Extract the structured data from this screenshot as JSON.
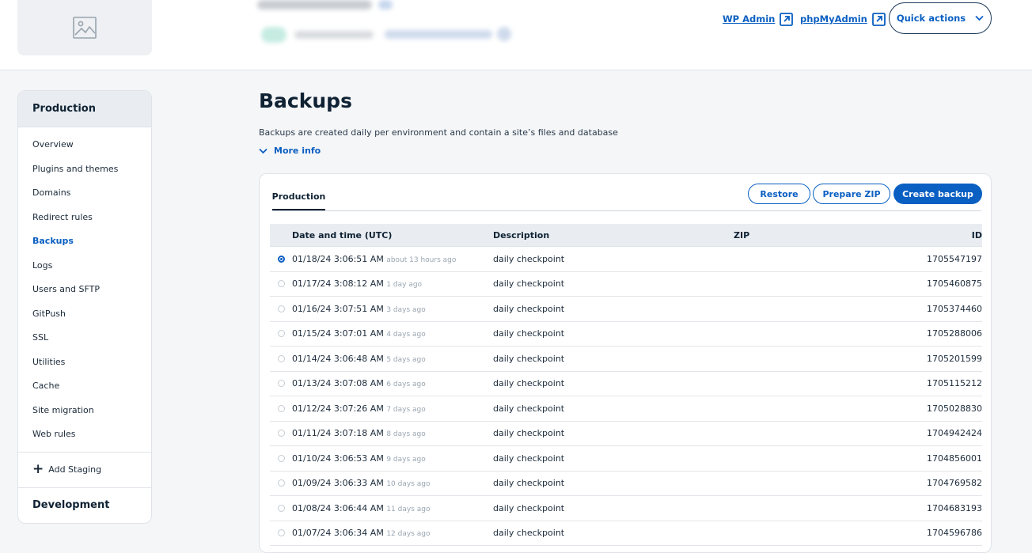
{
  "header": {
    "links": [
      {
        "label": "WP Admin",
        "icon": "external-link-icon"
      },
      {
        "label": "phpMyAdmin",
        "icon": "external-link-icon"
      }
    ],
    "quick_actions_label": "Quick actions",
    "site_thumbnail_icon": "image-placeholder-icon"
  },
  "sidebar": {
    "section_title": "Production",
    "items": [
      {
        "label": "Overview",
        "active": false
      },
      {
        "label": "Plugins and themes",
        "active": false
      },
      {
        "label": "Domains",
        "active": false
      },
      {
        "label": "Redirect rules",
        "active": false
      },
      {
        "label": "Backups",
        "active": true
      },
      {
        "label": "Logs",
        "active": false
      },
      {
        "label": "Users and SFTP",
        "active": false
      },
      {
        "label": "GitPush",
        "active": false
      },
      {
        "label": "SSL",
        "active": false
      },
      {
        "label": "Utilities",
        "active": false
      },
      {
        "label": "Cache",
        "active": false
      },
      {
        "label": "Site migration",
        "active": false
      },
      {
        "label": "Web rules",
        "active": false
      }
    ],
    "add_staging_label": "Add Staging",
    "development_title": "Development"
  },
  "main": {
    "title": "Backups",
    "description": "Backups are created daily per environment and contain a site’s files and database",
    "more_info_label": "More info",
    "tab_label": "Production",
    "buttons": {
      "restore": "Restore",
      "prepare_zip": "Prepare ZIP",
      "create_backup": "Create backup"
    },
    "table": {
      "headers": {
        "date": "Date and time (UTC)",
        "description": "Description",
        "zip": "ZIP",
        "id": "ID"
      },
      "rows": [
        {
          "date": "01/18/24 3:06:51 AM",
          "relative": "about 13 hours ago",
          "description": "daily checkpoint",
          "zip": "",
          "id": "1705547197",
          "selected": true
        },
        {
          "date": "01/17/24 3:08:12 AM",
          "relative": "1 day ago",
          "description": "daily checkpoint",
          "zip": "",
          "id": "1705460875",
          "selected": false
        },
        {
          "date": "01/16/24 3:07:51 AM",
          "relative": "3 days ago",
          "description": "daily checkpoint",
          "zip": "",
          "id": "1705374460",
          "selected": false
        },
        {
          "date": "01/15/24 3:07:01 AM",
          "relative": "4 days ago",
          "description": "daily checkpoint",
          "zip": "",
          "id": "1705288006",
          "selected": false
        },
        {
          "date": "01/14/24 3:06:48 AM",
          "relative": "5 days ago",
          "description": "daily checkpoint",
          "zip": "",
          "id": "1705201599",
          "selected": false
        },
        {
          "date": "01/13/24 3:07:08 AM",
          "relative": "6 days ago",
          "description": "daily checkpoint",
          "zip": "",
          "id": "1705115212",
          "selected": false
        },
        {
          "date": "01/12/24 3:07:26 AM",
          "relative": "7 days ago",
          "description": "daily checkpoint",
          "zip": "",
          "id": "1705028830",
          "selected": false
        },
        {
          "date": "01/11/24 3:07:18 AM",
          "relative": "8 days ago",
          "description": "daily checkpoint",
          "zip": "",
          "id": "1704942424",
          "selected": false
        },
        {
          "date": "01/10/24 3:06:53 AM",
          "relative": "9 days ago",
          "description": "daily checkpoint",
          "zip": "",
          "id": "1704856001",
          "selected": false
        },
        {
          "date": "01/09/24 3:06:33 AM",
          "relative": "10 days ago",
          "description": "daily checkpoint",
          "zip": "",
          "id": "1704769582",
          "selected": false
        },
        {
          "date": "01/08/24 3:06:44 AM",
          "relative": "11 days ago",
          "description": "daily checkpoint",
          "zip": "",
          "id": "1704683193",
          "selected": false
        },
        {
          "date": "01/07/24 3:06:34 AM",
          "relative": "12 days ago",
          "description": "daily checkpoint",
          "zip": "",
          "id": "1704596786",
          "selected": false
        }
      ]
    }
  },
  "colors": {
    "accent": "#0a5fc2",
    "heading": "#0f2233",
    "background": "#f5f6f8",
    "sidebar_header": "#e9edf2"
  }
}
